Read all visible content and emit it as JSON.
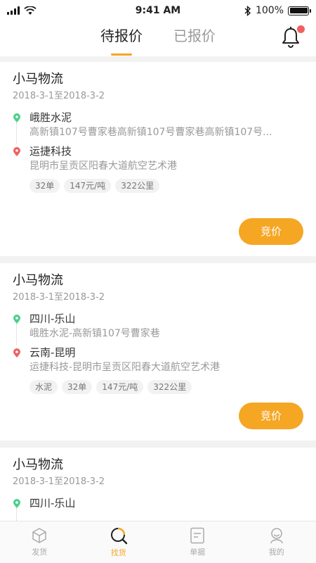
{
  "status_bar": {
    "time": "9:41 AM",
    "battery": "100%",
    "battery_level": 1.0
  },
  "header": {
    "tabs": [
      {
        "label": "待报价",
        "active": true
      },
      {
        "label": "已报价",
        "active": false
      }
    ],
    "notification_icon": "bell-icon"
  },
  "orders": [
    {
      "company": "小马物流",
      "date_range": "2018-3-1至2018-3-2",
      "origin": {
        "name": "峨胜水泥",
        "address": "高新镇107号曹家巷高新镇107号曹家巷高新镇107号..."
      },
      "destination": {
        "name": "运捷科技",
        "address": "昆明市呈贡区阳春大道航空艺术港"
      },
      "tags": [
        "32单",
        "147元/吨",
        "322公里"
      ],
      "action_label": "竞价"
    },
    {
      "company": "小马物流",
      "date_range": "2018-3-1至2018-3-2",
      "origin": {
        "name": "四川-乐山",
        "address": "峨胜水泥-高新镇107号曹家巷"
      },
      "destination": {
        "name": "云南-昆明",
        "address": "运捷科技-昆明市呈贡区阳春大道航空艺术港"
      },
      "tags": [
        "水泥",
        "32单",
        "147元/吨",
        "322公里"
      ],
      "action_label": "竞价"
    },
    {
      "company": "小马物流",
      "date_range": "2018-3-1至2018-3-2",
      "origin": {
        "name": "四川-乐山",
        "address": ""
      },
      "destination": {
        "name": "",
        "address": ""
      },
      "tags": [],
      "action_label": ""
    }
  ],
  "tabbar": [
    {
      "label": "发货",
      "icon": "box-icon",
      "active": false
    },
    {
      "label": "找货",
      "icon": "search-icon",
      "active": true
    },
    {
      "label": "单据",
      "icon": "document-icon",
      "active": false
    },
    {
      "label": "我的",
      "icon": "user-icon",
      "active": false
    }
  ],
  "colors": {
    "accent": "#f5a623",
    "origin_pin": "#4cd08a",
    "destination_pin": "#f06060",
    "badge": "#f06060"
  }
}
